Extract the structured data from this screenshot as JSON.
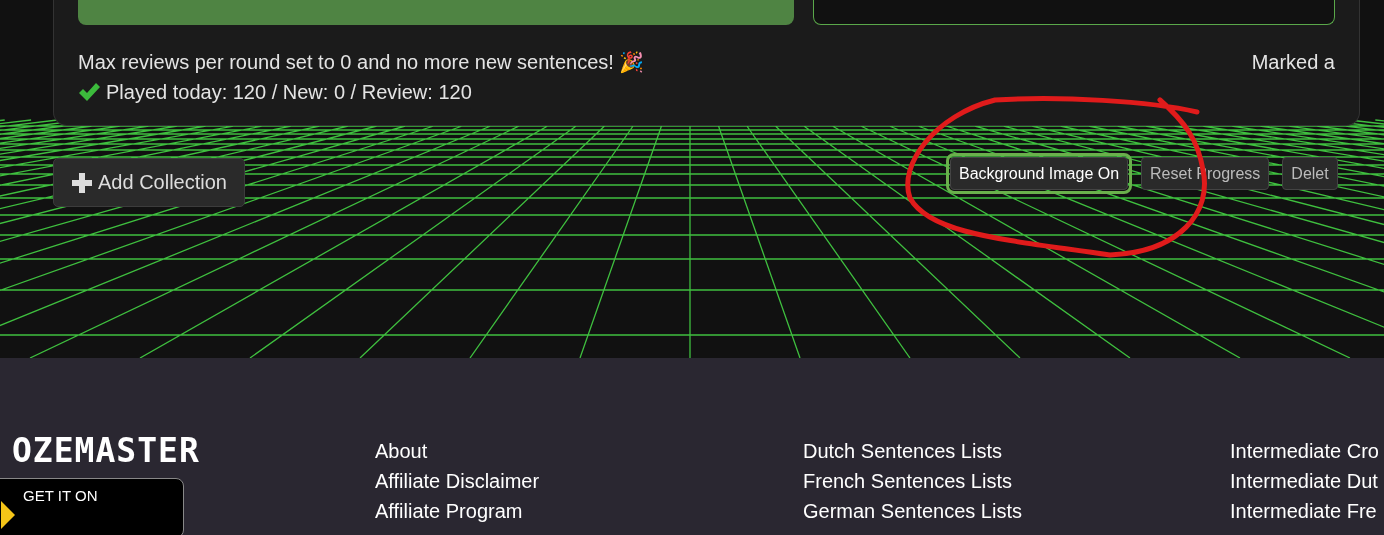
{
  "summary": {
    "message": "Max reviews per round set to 0 and no more new sentences! 🎉",
    "played": "Played today: 120 / New: 0 / Review: 120",
    "marked": "Marked a"
  },
  "add_button": {
    "label": "Add Collection"
  },
  "toolbar": [
    {
      "label": "Background Image On",
      "focused": true
    },
    {
      "label": "Reset Progress",
      "focused": false
    },
    {
      "label": "Delet",
      "focused": false
    }
  ],
  "footer": {
    "logo": "OZEMASTER",
    "badge": "GET IT ON",
    "columns": [
      [
        "About",
        "Affiliate Disclaimer",
        "Affiliate Program"
      ],
      [
        "Dutch Sentences Lists",
        "French Sentences Lists",
        "German Sentences Lists"
      ],
      [
        "Intermediate Cro",
        "Intermediate Dut",
        "Intermediate Fre"
      ]
    ]
  }
}
